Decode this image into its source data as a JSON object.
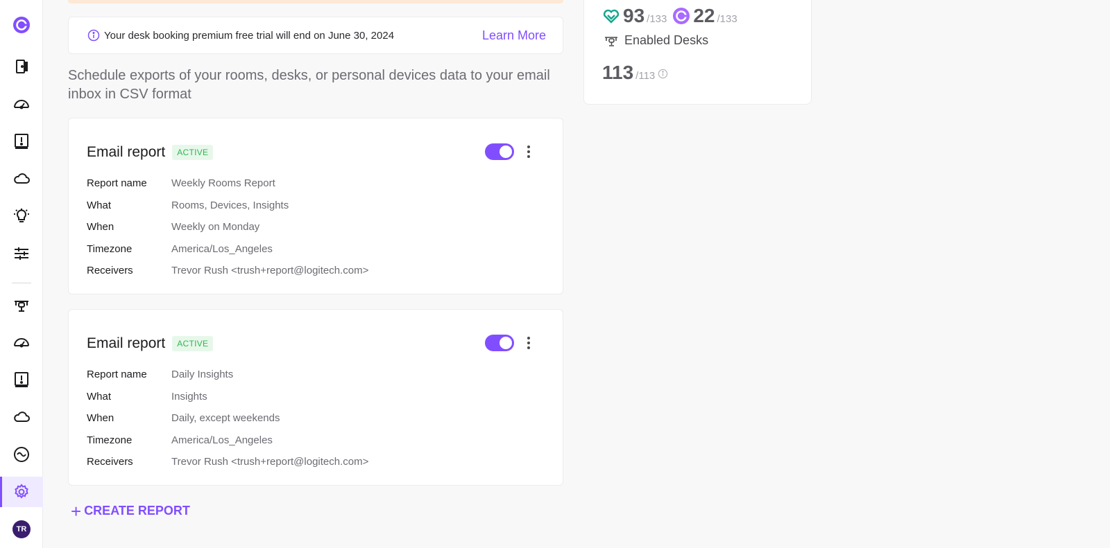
{
  "sidebar": {
    "items": [
      {
        "name": "logo-icon"
      },
      {
        "name": "room-door-icon"
      },
      {
        "name": "dashboard-gauge-icon"
      },
      {
        "name": "alert-report-icon"
      },
      {
        "name": "cloud-icon"
      },
      {
        "name": "insights-bulb-icon"
      },
      {
        "name": "sliders-icon"
      },
      {
        "name": "desk-chair-icon"
      },
      {
        "name": "dashboard-gauge-icon"
      },
      {
        "name": "alert-report-icon"
      },
      {
        "name": "cloud-icon"
      },
      {
        "name": "integrations-icon"
      },
      {
        "name": "settings-gear-icon",
        "active": true
      }
    ],
    "avatar_initials": "TR"
  },
  "banner": {
    "text": "Your desk booking premium free trial will end on June 30, 2024",
    "link": "Learn More"
  },
  "description": "Schedule exports of your rooms, desks, or personal devices data to your email inbox in CSV format",
  "reports": [
    {
      "title": "Email report",
      "status": "ACTIVE",
      "enabled": true,
      "fields": [
        {
          "label": "Report name",
          "value": "Weekly Rooms Report"
        },
        {
          "label": "What",
          "value": "Rooms, Devices, Insights"
        },
        {
          "label": "When",
          "value": "Weekly on Monday"
        },
        {
          "label": "Timezone",
          "value": "America/Los_Angeles"
        },
        {
          "label": "Receivers",
          "value": "Trevor Rush <trush+report@logitech.com>"
        }
      ]
    },
    {
      "title": "Email report",
      "status": "ACTIVE",
      "enabled": true,
      "fields": [
        {
          "label": "Report name",
          "value": "Daily Insights"
        },
        {
          "label": "What",
          "value": "Insights"
        },
        {
          "label": "When",
          "value": "Daily, except weekends"
        },
        {
          "label": "Timezone",
          "value": "America/Los_Angeles"
        },
        {
          "label": "Receivers",
          "value": "Trevor Rush <trush+report@logitech.com>"
        }
      ]
    }
  ],
  "create_report_label": "CREATE REPORT",
  "summary": {
    "healthy_count": "93",
    "healthy_total": "/133",
    "sync_count": "22",
    "sync_total": "/133",
    "enabled_desks_label": "Enabled Desks",
    "desks_count": "113",
    "desks_total": "/113"
  },
  "colors": {
    "accent": "#814eff",
    "active_badge_text": "#2fb553",
    "active_badge_bg": "#e7f8ea",
    "healthy_icon": "#17a58f"
  }
}
